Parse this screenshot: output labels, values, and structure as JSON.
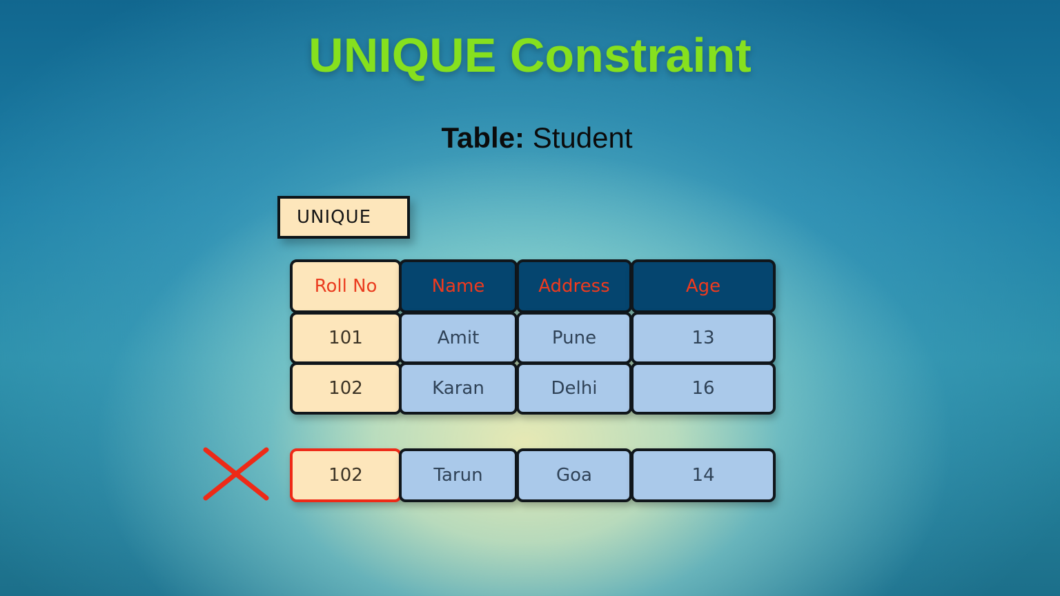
{
  "title": "UNIQUE Constraint",
  "subtitle": {
    "label": "Table:",
    "name": "Student"
  },
  "constraint_tag": "UNIQUE",
  "colors": {
    "title": "#86e01e",
    "header_bg": "#05456f",
    "header_text": "#f03a1e",
    "key_column_bg": "#fde6bb",
    "value_cell_bg": "#aac9ea",
    "error": "#ee2a17"
  },
  "table": {
    "columns": [
      "Roll No",
      "Name",
      "Address",
      "Age"
    ],
    "unique_column": "Roll No",
    "rows": [
      [
        "101",
        "Amit",
        "Pune",
        "13"
      ],
      [
        "102",
        "Karan",
        "Delhi",
        "16"
      ]
    ]
  },
  "rejected_row": {
    "values": [
      "102",
      "Tarun",
      "Goa",
      "14"
    ],
    "status": "rejected",
    "icon": "cross-icon"
  }
}
